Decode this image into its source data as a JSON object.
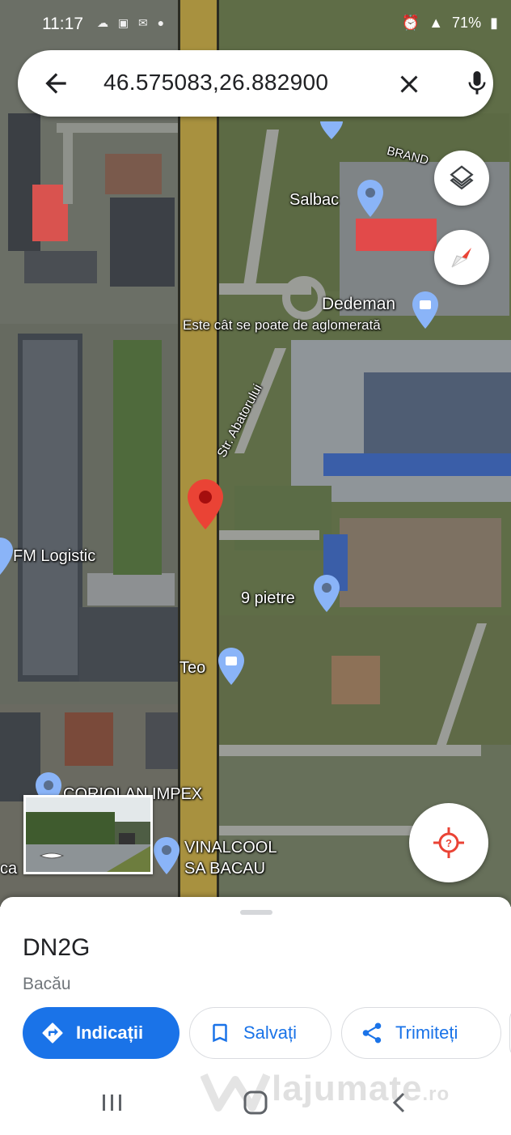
{
  "status_bar": {
    "time": "11:17",
    "battery": "71%"
  },
  "search": {
    "query": "46.575083,26.882900",
    "back_icon": "arrow-back-icon",
    "clear_icon": "close-icon",
    "mic_icon": "microphone-icon"
  },
  "map": {
    "labels": {
      "brand": "BRAND",
      "salbac": "Salbac",
      "dedeman": "Dedeman",
      "dedeman_sub": "Este cât se poate de aglomerată",
      "street_abatorului": "Str. Abatorului",
      "fm_logistic": "FM Logistic",
      "noua_pietre": "9 pietre",
      "teo": "Teo",
      "coriolan": "CORIOLAN IMPEX",
      "vinalcool_1": "VINALCOOL",
      "vinalcool_2": "SA BACAU",
      "edge_ca": "ca"
    },
    "colors": {
      "road": "#a8913f",
      "pin": "#ea4335",
      "place_pin": "#8ab4f8"
    }
  },
  "place": {
    "title": "DN2G",
    "subtitle": "Bacău"
  },
  "actions": {
    "directions": "Indicații",
    "save": "Salvați",
    "share": "Trimiteți"
  },
  "watermark": {
    "name": "lajumate",
    "suffix": ".ro"
  }
}
